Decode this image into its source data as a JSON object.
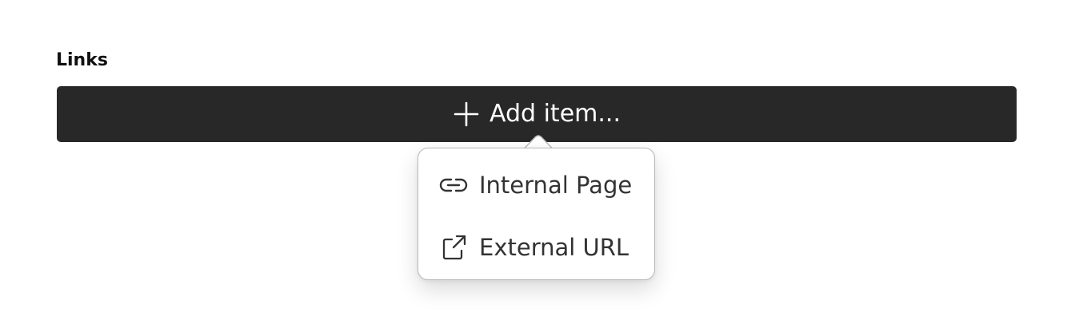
{
  "section": {
    "label": "Links"
  },
  "add_button": {
    "label": "Add item...",
    "icon": "plus-icon"
  },
  "menu": {
    "items": [
      {
        "label": "Internal Page",
        "icon": "link-icon"
      },
      {
        "label": "External URL",
        "icon": "external-link-icon"
      }
    ]
  },
  "colors": {
    "button_bg": "#282828",
    "button_text": "#ffffff",
    "menu_text": "#333333",
    "popover_border": "#b9b9b9"
  }
}
